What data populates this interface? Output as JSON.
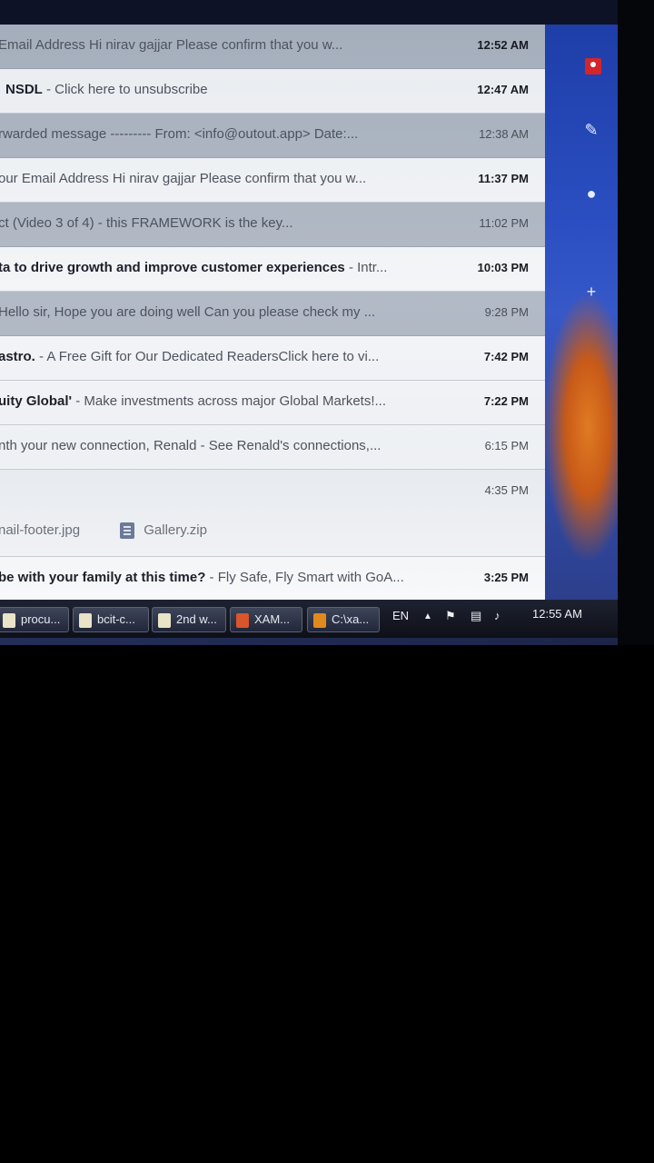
{
  "emails": [
    {
      "subject": "",
      "snippet": "Email Address Hi nirav gajjar Please confirm that you w...",
      "time": "12:52 AM",
      "unread": true,
      "tone": "dark"
    },
    {
      "subject": "NSDL",
      "snippet": " - Click here to unsubscribe",
      "time": "12:47 AM",
      "unread": true,
      "tone": "light"
    },
    {
      "subject": "",
      "snippet": "rwarded message --------- From: <info@outout.app> Date:...",
      "time": "12:38 AM",
      "unread": false,
      "tone": "dark"
    },
    {
      "subject": "",
      "snippet": "our Email Address Hi nirav gajjar Please confirm that you w...",
      "time": "11:37 PM",
      "unread": true,
      "tone": "light"
    },
    {
      "subject": "",
      "snippet": "ct (Video 3 of 4) - this FRAMEWORK is the key...",
      "time": "11:02 PM",
      "unread": false,
      "tone": "dark"
    },
    {
      "subject": "ta to drive growth and improve customer experiences",
      "snippet": " - Intr...",
      "time": "10:03 PM",
      "unread": true,
      "tone": "light"
    },
    {
      "subject": "",
      "snippet": "Hello sir, Hope you are doing well Can you please check my ...",
      "time": "9:28 PM",
      "unread": false,
      "tone": "dark"
    },
    {
      "subject": "astro.",
      "snippet": " - A Free Gift for Our Dedicated ReadersClick here to vi...",
      "time": "7:42 PM",
      "unread": true,
      "tone": "light"
    },
    {
      "subject": "uity Global'",
      "snippet": " - Make investments across major Global Markets!...",
      "time": "7:22 PM",
      "unread": true,
      "tone": "light"
    },
    {
      "subject": "",
      "snippet": "nth your new connection, Renald - See Renald's connections,...",
      "time": "6:15 PM",
      "unread": false,
      "tone": "light"
    },
    {
      "subject": "",
      "snippet": "",
      "time": "4:35 PM",
      "unread": false,
      "tone": "light"
    },
    {
      "subject": "be with your family at this time?",
      "snippet": " - Fly Safe, Fly Smart with GoA...",
      "time": "3:25 PM",
      "unread": true,
      "tone": "light"
    }
  ],
  "attachments": {
    "file1": "nail-footer.jpg",
    "file2": "Gallery.zip"
  },
  "taskbar": {
    "items": [
      "procu...",
      "bcit-c...",
      "2nd w...",
      "XAM...",
      "C:\\xa..."
    ],
    "item_icon_colors": [
      "#e9e4c8",
      "#e9e4c8",
      "#e9e4c8",
      "#d9552b",
      "#e08a1e"
    ],
    "language": "EN",
    "clock": "12:55 AM"
  },
  "side_icons": [
    "notification-badge-icon",
    "pencil-icon",
    "person-icon",
    "plus-icon"
  ]
}
